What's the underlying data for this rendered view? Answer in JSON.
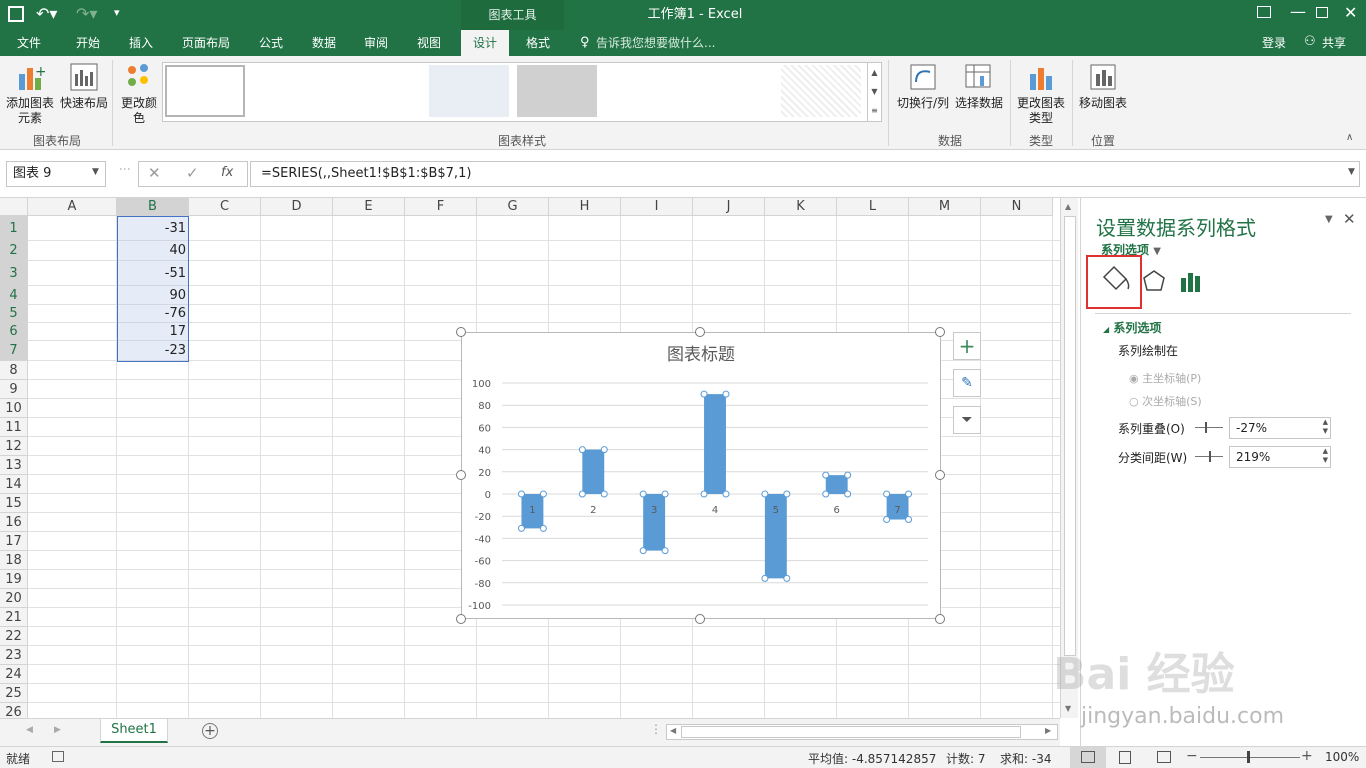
{
  "titlebar": {
    "title": "工作簿1 - Excel",
    "context_tab": "图表工具"
  },
  "tabs": [
    {
      "label": "文件"
    },
    {
      "label": "开始"
    },
    {
      "label": "插入"
    },
    {
      "label": "页面布局"
    },
    {
      "label": "公式"
    },
    {
      "label": "数据"
    },
    {
      "label": "审阅"
    },
    {
      "label": "视图"
    },
    {
      "label": "设计"
    },
    {
      "label": "格式"
    }
  ],
  "tellme": "告诉我您想要做什么...",
  "login": "登录",
  "share": "共享",
  "ribbon": {
    "add_element": "添加图表元素",
    "quick_layout": "快速布局",
    "change_color": "更改颜色",
    "group_layout": "图表布局",
    "group_styles": "图表样式",
    "switch_rowcol": "切换行/列",
    "select_data": "选择数据",
    "group_data": "数据",
    "change_type": "更改图表类型",
    "group_type": "类型",
    "move_chart": "移动图表",
    "group_location": "位置"
  },
  "formula": {
    "namebox": "图表 9",
    "fx": "fx",
    "content": "=SERIES(,,Sheet1!$B$1:$B$7,1)"
  },
  "columns": [
    "A",
    "B",
    "C",
    "D",
    "E",
    "F",
    "G",
    "H",
    "I",
    "J",
    "K",
    "L",
    "M",
    "N"
  ],
  "rows": [
    "1",
    "2",
    "3",
    "4",
    "5",
    "6",
    "7",
    "8",
    "9",
    "10",
    "11",
    "12",
    "13",
    "14",
    "15",
    "16",
    "17",
    "18",
    "19",
    "20",
    "21",
    "22",
    "23",
    "24",
    "25",
    "26"
  ],
  "cells_b": [
    "-31",
    "40",
    "-51",
    "90",
    "-76",
    "17",
    "-23"
  ],
  "chart_data": {
    "type": "bar",
    "title": "图表标题",
    "categories": [
      "1",
      "2",
      "3",
      "4",
      "5",
      "6",
      "7"
    ],
    "values": [
      -31,
      40,
      -51,
      90,
      -76,
      17,
      -23
    ],
    "ylim": [
      -100,
      100
    ],
    "yticks": [
      "100",
      "80",
      "60",
      "40",
      "20",
      "0",
      "-20",
      "-40",
      "-60",
      "-80",
      "-100"
    ],
    "grid": true,
    "color": "#5b9bd5"
  },
  "panel": {
    "title": "设置数据系列格式",
    "subtitle": "系列选项",
    "section": "系列选项",
    "plot_on": "系列绘制在",
    "primary_axis": "主坐标轴(P)",
    "secondary_axis": "次坐标轴(S)",
    "overlap_label": "系列重叠(O)",
    "overlap_value": "-27%",
    "gap_label": "分类间距(W)",
    "gap_value": "219%"
  },
  "sheet_tab": "Sheet1",
  "status": {
    "ready": "就绪",
    "average": "平均值: -4.857142857",
    "count": "计数: 7",
    "sum": "求和: -34",
    "zoom": "100%"
  },
  "watermark": {
    "brand": "Bai 经验",
    "url": "jingyan.baidu.com"
  }
}
